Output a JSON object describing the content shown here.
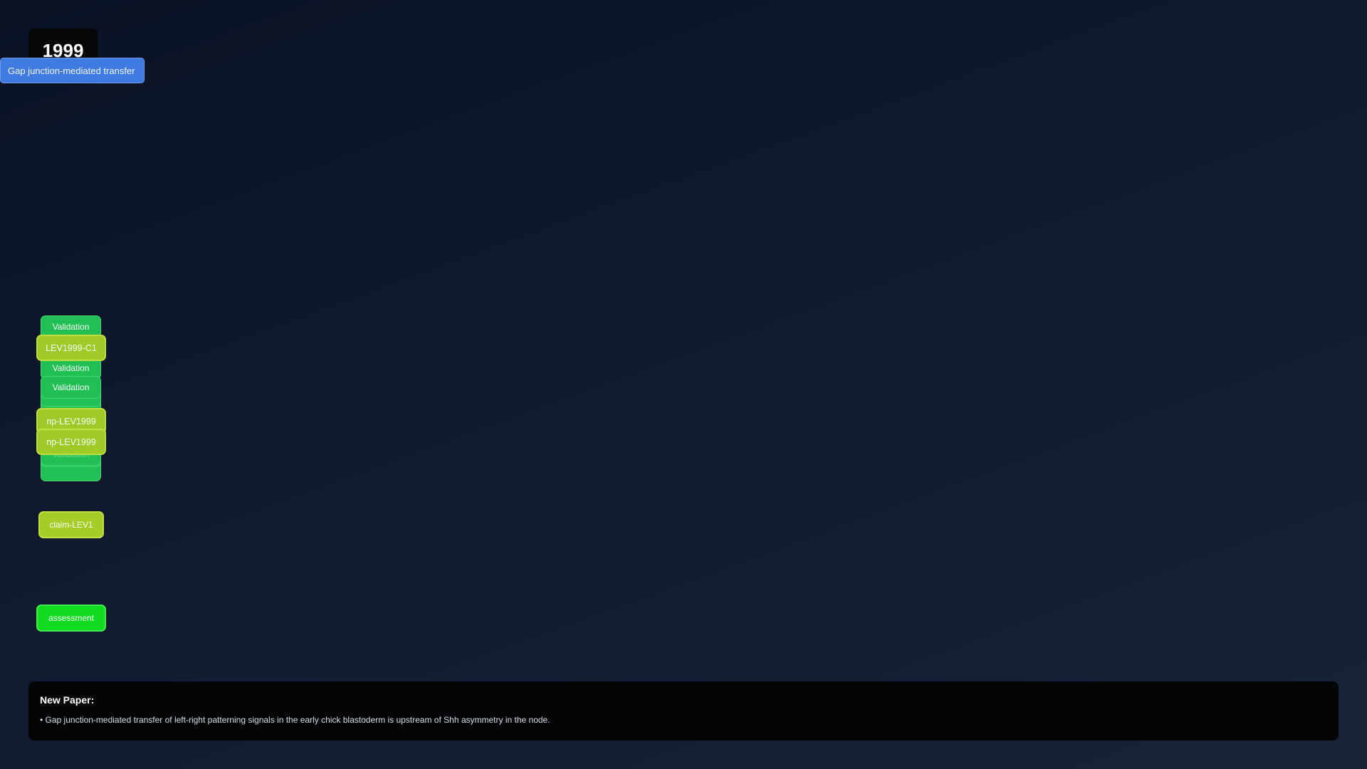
{
  "year": "1999",
  "paper_chip": "Gap junction-mediated transfer",
  "nodes": {
    "validation_label": "Validation",
    "lev_c1": "LEV1999-C1",
    "np_1": "np-LEV1999",
    "np_2": "np-LEV1999",
    "claim": "claim-LEV1",
    "assessment": "assessment"
  },
  "footer": {
    "title": "New Paper:",
    "bullet": "• Gap junction-mediated transfer of left-right patterning signals in the early chick blastoderm is upstream of Shh asymmetry in the node."
  },
  "colors": {
    "validation": "#22bf55",
    "claim": "#9fca28",
    "assessment": "#11dc22",
    "paper": "#3f7ae0"
  }
}
